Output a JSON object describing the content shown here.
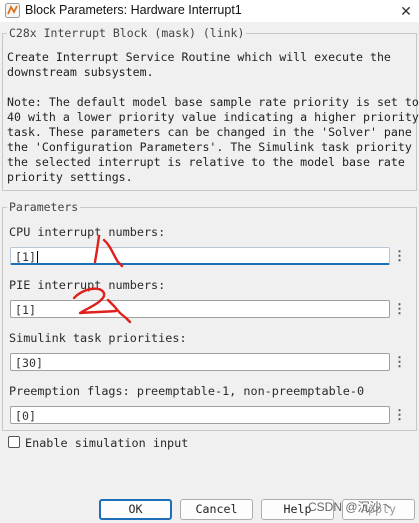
{
  "window": {
    "title": "Block Parameters: Hardware Interrupt1",
    "close_glyph": "✕",
    "app_icon": "simulink-block-icon"
  },
  "mask": {
    "legend": "C28x Interrupt Block (mask) (link)",
    "description_lines": [
      "Create Interrupt Service Routine which will execute the",
      "downstream subsystem.",
      "",
      "Note: The default model base sample rate priority is set to",
      "40 with a lower priority value indicating a higher priority",
      "task. These parameters can be changed in the 'Solver' pane of",
      "the 'Configuration Parameters'. The Simulink task priority of",
      "the selected interrupt is relative to the model base rate",
      "priority settings."
    ]
  },
  "parameters": {
    "legend": "Parameters",
    "fields": [
      {
        "label": "CPU interrupt numbers:",
        "value": "[1]",
        "more": "⋮"
      },
      {
        "label": "PIE interrupt numbers:",
        "value": "[1]",
        "more": "⋮"
      },
      {
        "label": "Simulink task priorities:",
        "value": "[30]",
        "more": "⋮"
      },
      {
        "label": "Preemption flags: preemptable-1, non-preemptable-0",
        "value": "[0]",
        "more": "⋮"
      }
    ],
    "checkbox": {
      "label": "Enable simulation input",
      "checked": false
    }
  },
  "buttons": {
    "ok": "OK",
    "cancel": "Cancel",
    "help": "Help",
    "apply": "Apply"
  },
  "watermark": "CSDN @沉沙丶",
  "colors": {
    "accent": "#1d6fb8",
    "annotation": "#e0201a",
    "background": "#f0f0f0"
  }
}
